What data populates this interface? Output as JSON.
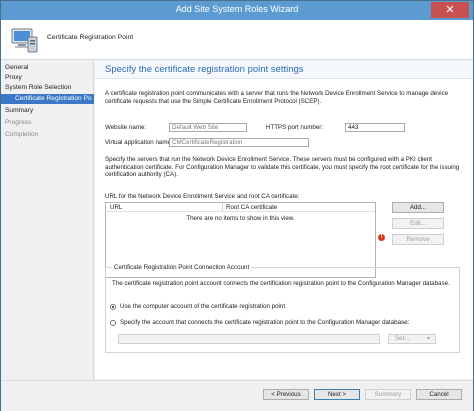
{
  "window": {
    "title": "Add Site System Roles Wizard",
    "close_glyph": "✕"
  },
  "header": {
    "title": "Certificate Registration Point",
    "icon": "computer-server-icon"
  },
  "nav": {
    "items": [
      {
        "label": "General"
      },
      {
        "label": "Proxy"
      },
      {
        "label": "System Role Selection"
      },
      {
        "label": "Certificate Registration Po"
      },
      {
        "label": "Summary"
      },
      {
        "label": "Progress"
      },
      {
        "label": "Completion"
      }
    ]
  },
  "content": {
    "title": "Specify the certificate registration point settings",
    "description": "A certificate registration point communicates with a server that runs the Network Device Enrollment Service to manage device certificate requests that use the Simple Certificate Enrollment Protocol (SCEP).",
    "website_label": "Website name:",
    "website_value": "Default Web Site",
    "https_label": "HTTPS port number:",
    "https_value": "443",
    "vapp_label": "Virtual application name:",
    "vapp_value": "CMCertificateRegistration",
    "servers_text": "Specify the servers that run the Network Device Enrollment Service.  These servers must be configured with a PKI client authentication certificate.  For Configuration Manager to validate this certificate, you must specify the root certificate for the issuing certification authority (CA).",
    "list_label": "URL for the Network Device Enrollment Service and root CA certificate:",
    "list_columns": [
      "URL",
      "Root CA certificate"
    ],
    "list_empty": "There are no items to show in this view.",
    "buttons": {
      "add": "Add...",
      "edit": "Edit...",
      "remove": "Remove"
    },
    "error_glyph": "!",
    "group": {
      "legend": "Certificate Registration Point Connection Account",
      "text": "The certificate registration point account connects the certification registration point to the Configuration Manager database.",
      "radio_computer": "Use the computer account of the certificate registration point",
      "radio_specify": "Specify the account that connects the certificate registration point to the Configuration Manager database:",
      "account_value": "",
      "set_label": "Set...",
      "set_arrow": "▼"
    }
  },
  "footer": {
    "previous": "< Previous",
    "next": "Next >",
    "summary": "Summary",
    "cancel": "Cancel"
  },
  "colors": {
    "accent": "#2e6bb5",
    "selection": "#3b78c6",
    "titlebar": "#5c9ad2",
    "close": "#c75050",
    "error": "#d9381e"
  }
}
